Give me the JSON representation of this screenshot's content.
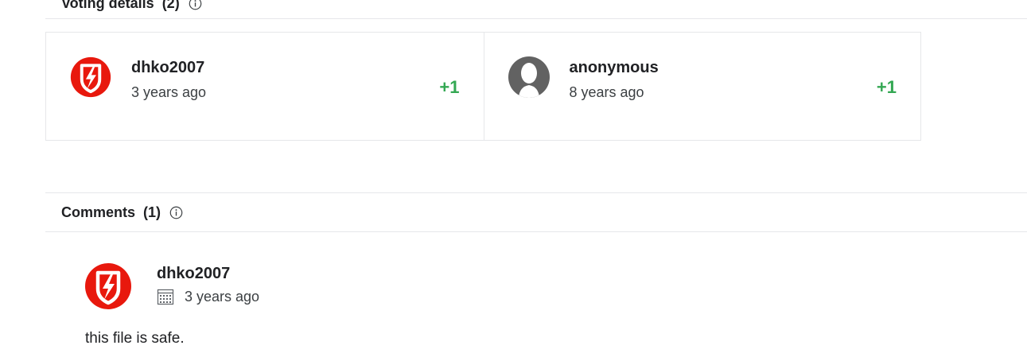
{
  "voting": {
    "title": "Voting details",
    "count": "(2)",
    "votes": [
      {
        "user": "dhko2007",
        "time": "3 years ago",
        "score": "+1",
        "avatar_icon": "red-lightning-shield-icon"
      },
      {
        "user": "anonymous",
        "time": "8 years ago",
        "score": "+1",
        "avatar_icon": "anonymous-person-icon"
      }
    ]
  },
  "comments": {
    "title": "Comments",
    "count": "(1)",
    "items": [
      {
        "user": "dhko2007",
        "time": "3 years ago",
        "text": "this file is safe.",
        "avatar_icon": "red-lightning-shield-icon"
      }
    ]
  },
  "colors": {
    "positive": "#34a853",
    "brand_red": "#e8180d",
    "border": "#e6e7ea"
  }
}
